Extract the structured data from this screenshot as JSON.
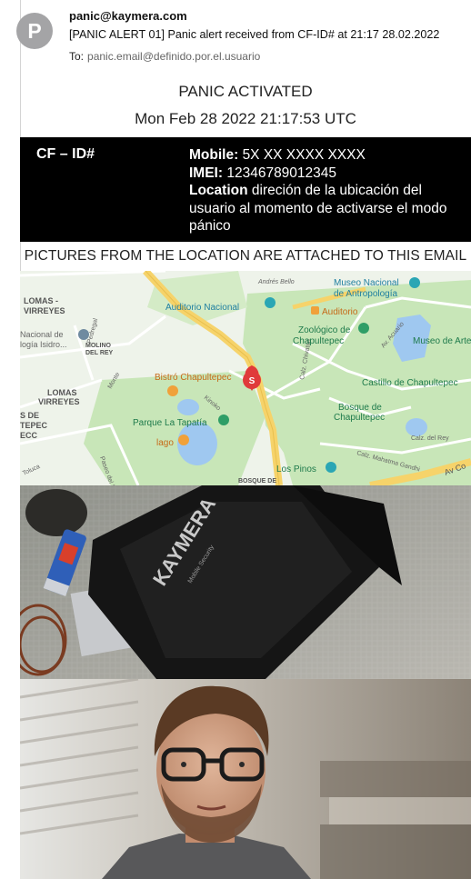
{
  "email": {
    "avatar_letter": "P",
    "from": "panic@kaymera.com",
    "subject": "[PANIC ALERT 01] Panic alert received from CF-ID# at 21:17 28.02.2022",
    "to_label": "To:",
    "to_address": "panic.email@definido.por.el.usuario"
  },
  "alert": {
    "title": "PANIC ACTIVATED",
    "datetime": "Mon Feb 28 2022 21:17:53 UTC",
    "cf_id_label": "CF – ID#",
    "mobile_label": "Mobile:",
    "mobile_value": "5X XX XXXX XXXX",
    "imei_label": "IMEI:",
    "imei_value": "12346789012345",
    "location_label": "Location",
    "location_value": "direción de la ubicación del usuario al momento de activarse el modo pánico",
    "pictures_note": "PICTURES FROM THE LOCATION ARE ATTACHED TO THIS EMAIL"
  },
  "map": {
    "labels": {
      "lomas_virreyes_top": [
        "LOMAS -",
        "VIRREYES"
      ],
      "nacional": [
        "Nacional de",
        "logía Isidro..."
      ],
      "molino": [
        "MOLINO",
        "DEL REY"
      ],
      "lomas_virreyes_mid": [
        "LOMAS",
        "VIRREYES"
      ],
      "s_de": [
        "S DE",
        "TEPEC",
        "ECC"
      ],
      "andres_bello": "Andrés Bello",
      "auditorio_nacional": "Auditorio Nacional",
      "museo_antropologia": [
        "Museo Nacional",
        "de Antropología"
      ],
      "auditorio": "Auditorio",
      "zoologico": [
        "Zoológico de",
        "Chapultepec"
      ],
      "museo_arte": "Museo de Arte",
      "bistro": "Bistró Chapultepec",
      "castillo": "Castillo de Chapultepec",
      "bosque": [
        "Bosque de",
        "Chapultepec"
      ],
      "parque": "Parque La Tapatía",
      "lago": "lago",
      "los_pinos": "Los Pinos",
      "bosque_de": "BOSQUE DE",
      "calz_chivatito": "Calz. Chivatito",
      "pedregal": "Pedregal",
      "monte": "Monte",
      "kinoko": "Kinoko",
      "toluca": "Toluca",
      "av_acuario": "Av. Acuario",
      "calz_del_rey": "Calz. del Rey",
      "mahatma": "Calz. Mahatma Gandhi",
      "av_co": "Av Co",
      "paseo_sope": "Paseo del Sope",
      "marker_letter": "S"
    },
    "colors": {
      "park": "#c8e6b8",
      "water": "#9fc8f0",
      "road_major": "#f6d36a",
      "marker": "#e03a3a",
      "poi_green": "#2f9e67",
      "poi_teal": "#2aa6b4",
      "poi_orange": "#f0a13a"
    }
  },
  "photos": {
    "photo1_case_text": "KAYMERA",
    "photo1_case_subtext": "Mobile Security"
  }
}
